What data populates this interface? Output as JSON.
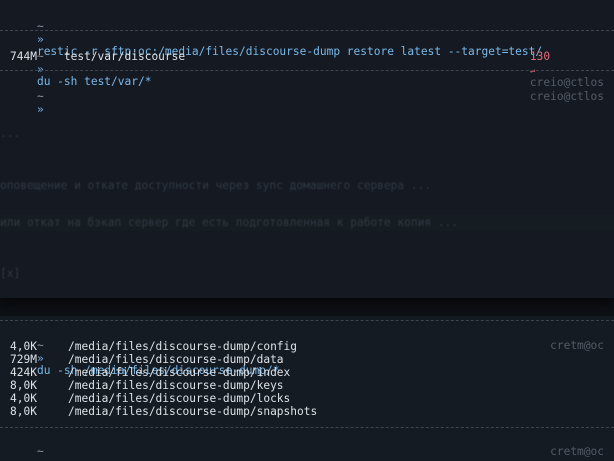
{
  "terminal_top": {
    "lines": [
      {
        "tilde": "~",
        "arrow": "»",
        "command": "restic -r sftp:oc:/media/files/discourse-dump restore latest --target=test/"
      },
      {
        "tilde": "~",
        "arrow": "»",
        "command": "du -sh test/var/*",
        "exit_code": "130",
        "exit_glyph": "↵",
        "host": "creio@ctlos"
      },
      {
        "output": "744M    test/var/discourse"
      },
      {
        "tilde": "~",
        "arrow": "»",
        "host": "creio@ctlos"
      }
    ]
  },
  "background_window": {
    "fragments": [
      "...",
      "оповещение и откате доступности через sync домашнего сервера ...",
      "или откат на бэкап сервер где есть подготовленная к работе копия ...",
      "[x]"
    ]
  },
  "terminal_bottom": {
    "prompt": {
      "tilde": "~",
      "arrow": "»",
      "command": "du -sh /media/files/discourse-dump/*",
      "host": "cretm@oc"
    },
    "rows": [
      {
        "size": "4,0K",
        "path": "/media/files/discourse-dump/config"
      },
      {
        "size": "729M",
        "path": "/media/files/discourse-dump/data"
      },
      {
        "size": "424K",
        "path": "/media/files/discourse-dump/index"
      },
      {
        "size": "8,0K",
        "path": "/media/files/discourse-dump/keys"
      },
      {
        "size": "4,0K",
        "path": "/media/files/discourse-dump/locks"
      },
      {
        "size": "8,0K",
        "path": "/media/files/discourse-dump/snapshots"
      }
    ],
    "last_prompt": {
      "tilde": "~",
      "arrow": "»",
      "host": "cretm@oc"
    }
  },
  "colors": {
    "background": "#0d1015",
    "terminal_bg": "#151a22",
    "command": "#7ab8e8",
    "error": "#e46b7a",
    "dim_host": "#535b66"
  }
}
